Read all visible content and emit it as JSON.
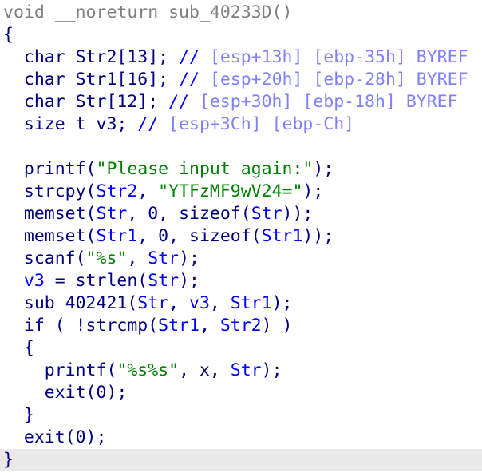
{
  "colors": {
    "background": "#ffffff",
    "code": "#000080",
    "string": "#008000",
    "local_var": "#0000ff",
    "comment": "#0000ff",
    "stack_comment": "#8080ff",
    "header": "#808080",
    "current_line": "#e9e9e9"
  },
  "code": {
    "current_line_index": 20,
    "lines": [
      [
        {
          "t": "void __noreturn sub_40233D()",
          "c": "g"
        }
      ],
      [
        {
          "t": "{",
          "c": "k"
        }
      ],
      [
        {
          "t": "  char ",
          "c": "k"
        },
        {
          "t": "Str2[13]",
          "c": "v"
        },
        {
          "t": "; ",
          "c": "k"
        },
        {
          "t": "// ",
          "c": "c"
        },
        {
          "t": "[esp+13h] [ebp-35h] BYREF",
          "c": "x"
        }
      ],
      [
        {
          "t": "  char ",
          "c": "k"
        },
        {
          "t": "Str1[16]",
          "c": "v"
        },
        {
          "t": "; ",
          "c": "k"
        },
        {
          "t": "// ",
          "c": "c"
        },
        {
          "t": "[esp+20h] [ebp-28h] BYREF",
          "c": "x"
        }
      ],
      [
        {
          "t": "  char ",
          "c": "k"
        },
        {
          "t": "Str[12]",
          "c": "v"
        },
        {
          "t": "; ",
          "c": "k"
        },
        {
          "t": "// ",
          "c": "c"
        },
        {
          "t": "[esp+30h] [ebp-18h] BYREF",
          "c": "x"
        }
      ],
      [
        {
          "t": "  size_t ",
          "c": "k"
        },
        {
          "t": "v3",
          "c": "v"
        },
        {
          "t": "; ",
          "c": "k"
        },
        {
          "t": "// ",
          "c": "c"
        },
        {
          "t": "[esp+3Ch] [ebp-Ch]",
          "c": "x"
        }
      ],
      [
        {
          "t": "",
          "c": "k"
        }
      ],
      [
        {
          "t": "  printf(",
          "c": "k"
        },
        {
          "t": "\"Please input again:\"",
          "c": "s"
        },
        {
          "t": ");",
          "c": "k"
        }
      ],
      [
        {
          "t": "  strcpy(",
          "c": "k"
        },
        {
          "t": "Str2",
          "c": "l"
        },
        {
          "t": ", ",
          "c": "k"
        },
        {
          "t": "\"YTFzMF9wV24=\"",
          "c": "s"
        },
        {
          "t": ");",
          "c": "k"
        }
      ],
      [
        {
          "t": "  memset(",
          "c": "k"
        },
        {
          "t": "Str",
          "c": "l"
        },
        {
          "t": ", 0, sizeof(",
          "c": "k"
        },
        {
          "t": "Str",
          "c": "l"
        },
        {
          "t": "));",
          "c": "k"
        }
      ],
      [
        {
          "t": "  memset(",
          "c": "k"
        },
        {
          "t": "Str1",
          "c": "l"
        },
        {
          "t": ", 0, sizeof(",
          "c": "k"
        },
        {
          "t": "Str1",
          "c": "l"
        },
        {
          "t": "));",
          "c": "k"
        }
      ],
      [
        {
          "t": "  scanf(",
          "c": "k"
        },
        {
          "t": "\"%s\"",
          "c": "s"
        },
        {
          "t": ", ",
          "c": "k"
        },
        {
          "t": "Str",
          "c": "l"
        },
        {
          "t": ");",
          "c": "k"
        }
      ],
      [
        {
          "t": "  ",
          "c": "k"
        },
        {
          "t": "v3",
          "c": "l"
        },
        {
          "t": " = strlen(",
          "c": "k"
        },
        {
          "t": "Str",
          "c": "l"
        },
        {
          "t": ");",
          "c": "k"
        }
      ],
      [
        {
          "t": "  sub_402421(",
          "c": "k"
        },
        {
          "t": "Str",
          "c": "l"
        },
        {
          "t": ", ",
          "c": "k"
        },
        {
          "t": "v3",
          "c": "l"
        },
        {
          "t": ", ",
          "c": "k"
        },
        {
          "t": "Str1",
          "c": "l"
        },
        {
          "t": ");",
          "c": "k"
        }
      ],
      [
        {
          "t": "  if ( !strcmp(",
          "c": "k"
        },
        {
          "t": "Str1",
          "c": "l"
        },
        {
          "t": ", ",
          "c": "k"
        },
        {
          "t": "Str2",
          "c": "l"
        },
        {
          "t": ") )",
          "c": "k"
        }
      ],
      [
        {
          "t": "  {",
          "c": "k"
        }
      ],
      [
        {
          "t": "    printf(",
          "c": "k"
        },
        {
          "t": "\"%s%s\"",
          "c": "s"
        },
        {
          "t": ", x, ",
          "c": "k"
        },
        {
          "t": "Str",
          "c": "l"
        },
        {
          "t": ");",
          "c": "k"
        }
      ],
      [
        {
          "t": "    exit(0);",
          "c": "k"
        }
      ],
      [
        {
          "t": "  }",
          "c": "k"
        }
      ],
      [
        {
          "t": "  exit(0);",
          "c": "k"
        }
      ],
      [
        {
          "t": "}",
          "c": "k"
        }
      ]
    ]
  }
}
